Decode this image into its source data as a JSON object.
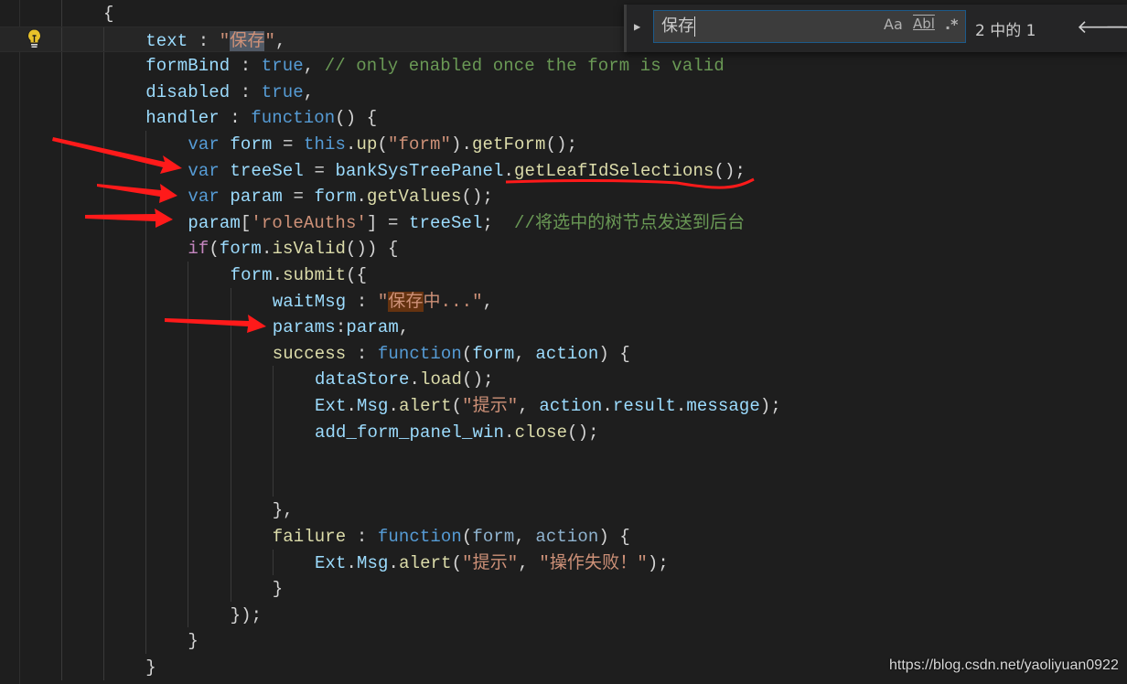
{
  "editor": {
    "current_line": 1,
    "lines": [
      {
        "indent": 0,
        "tokens": [
          {
            "t": "{",
            "c": "pun"
          }
        ]
      },
      {
        "indent": 1,
        "tokens": [
          {
            "t": "text",
            "c": "prop"
          },
          {
            "t": " : ",
            "c": "pun"
          },
          {
            "t": "\"",
            "c": "str"
          },
          {
            "t": "保存",
            "c": "str hl-grey"
          },
          {
            "t": "\"",
            "c": "str"
          },
          {
            "t": ",",
            "c": "pun"
          }
        ]
      },
      {
        "indent": 1,
        "tokens": [
          {
            "t": "formBind",
            "c": "prop"
          },
          {
            "t": " : ",
            "c": "pun"
          },
          {
            "t": "true",
            "c": "kw"
          },
          {
            "t": ", ",
            "c": "pun"
          },
          {
            "t": "// only enabled once the form is valid",
            "c": "com"
          }
        ]
      },
      {
        "indent": 1,
        "tokens": [
          {
            "t": "disabled",
            "c": "prop"
          },
          {
            "t": " : ",
            "c": "pun"
          },
          {
            "t": "true",
            "c": "kw"
          },
          {
            "t": ",",
            "c": "pun"
          }
        ]
      },
      {
        "indent": 1,
        "tokens": [
          {
            "t": "handler",
            "c": "prop"
          },
          {
            "t": " : ",
            "c": "pun"
          },
          {
            "t": "function",
            "c": "kw"
          },
          {
            "t": "() {",
            "c": "pun"
          }
        ]
      },
      {
        "indent": 2,
        "tokens": [
          {
            "t": "var",
            "c": "kw"
          },
          {
            "t": " ",
            "c": "pun"
          },
          {
            "t": "form",
            "c": "prop"
          },
          {
            "t": " = ",
            "c": "pun"
          },
          {
            "t": "this",
            "c": "kw"
          },
          {
            "t": ".",
            "c": "pun"
          },
          {
            "t": "up",
            "c": "fn"
          },
          {
            "t": "(",
            "c": "pun"
          },
          {
            "t": "\"form\"",
            "c": "str"
          },
          {
            "t": ").",
            "c": "pun"
          },
          {
            "t": "getForm",
            "c": "fn"
          },
          {
            "t": "();",
            "c": "pun"
          }
        ]
      },
      {
        "indent": 2,
        "tokens": [
          {
            "t": "var",
            "c": "kw"
          },
          {
            "t": " ",
            "c": "pun"
          },
          {
            "t": "treeSel",
            "c": "prop"
          },
          {
            "t": " = ",
            "c": "pun"
          },
          {
            "t": "bankSysTreePanel",
            "c": "prop"
          },
          {
            "t": ".",
            "c": "pun"
          },
          {
            "t": "getLeafIdSelections",
            "c": "fn"
          },
          {
            "t": "();",
            "c": "pun"
          }
        ]
      },
      {
        "indent": 2,
        "tokens": [
          {
            "t": "var",
            "c": "kw"
          },
          {
            "t": " ",
            "c": "pun"
          },
          {
            "t": "param",
            "c": "prop"
          },
          {
            "t": " = ",
            "c": "pun"
          },
          {
            "t": "form",
            "c": "prop"
          },
          {
            "t": ".",
            "c": "pun"
          },
          {
            "t": "getValues",
            "c": "fn"
          },
          {
            "t": "();",
            "c": "pun"
          }
        ]
      },
      {
        "indent": 2,
        "tokens": [
          {
            "t": "param",
            "c": "prop"
          },
          {
            "t": "[",
            "c": "pun"
          },
          {
            "t": "'roleAuths'",
            "c": "str"
          },
          {
            "t": "] = ",
            "c": "pun"
          },
          {
            "t": "treeSel",
            "c": "prop"
          },
          {
            "t": ";  ",
            "c": "pun"
          },
          {
            "t": "//将选中的树节点发送到后台",
            "c": "com"
          }
        ]
      },
      {
        "indent": 2,
        "tokens": [
          {
            "t": "if",
            "c": "ctl"
          },
          {
            "t": "(",
            "c": "pun"
          },
          {
            "t": "form",
            "c": "prop"
          },
          {
            "t": ".",
            "c": "pun"
          },
          {
            "t": "isValid",
            "c": "fn"
          },
          {
            "t": "()) {",
            "c": "pun"
          }
        ]
      },
      {
        "indent": 3,
        "tokens": [
          {
            "t": "form",
            "c": "prop"
          },
          {
            "t": ".",
            "c": "pun"
          },
          {
            "t": "submit",
            "c": "fn"
          },
          {
            "t": "({",
            "c": "pun"
          }
        ]
      },
      {
        "indent": 4,
        "tokens": [
          {
            "t": "waitMsg",
            "c": "prop"
          },
          {
            "t": " : ",
            "c": "pun"
          },
          {
            "t": "\"",
            "c": "str"
          },
          {
            "t": "保存",
            "c": "str hl-orange"
          },
          {
            "t": "中...\"",
            "c": "str"
          },
          {
            "t": ",",
            "c": "pun"
          }
        ]
      },
      {
        "indent": 4,
        "tokens": [
          {
            "t": "params",
            "c": "prop"
          },
          {
            "t": ":",
            "c": "pun"
          },
          {
            "t": "param",
            "c": "prop"
          },
          {
            "t": ",",
            "c": "pun"
          }
        ]
      },
      {
        "indent": 4,
        "tokens": [
          {
            "t": "success",
            "c": "fn"
          },
          {
            "t": " : ",
            "c": "pun"
          },
          {
            "t": "function",
            "c": "kw"
          },
          {
            "t": "(",
            "c": "pun"
          },
          {
            "t": "form",
            "c": "prop"
          },
          {
            "t": ", ",
            "c": "pun"
          },
          {
            "t": "action",
            "c": "prop"
          },
          {
            "t": ") {",
            "c": "pun"
          }
        ]
      },
      {
        "indent": 5,
        "tokens": [
          {
            "t": "dataStore",
            "c": "prop"
          },
          {
            "t": ".",
            "c": "pun"
          },
          {
            "t": "load",
            "c": "fn"
          },
          {
            "t": "();",
            "c": "pun"
          }
        ]
      },
      {
        "indent": 5,
        "tokens": [
          {
            "t": "Ext",
            "c": "prop"
          },
          {
            "t": ".",
            "c": "pun"
          },
          {
            "t": "Msg",
            "c": "prop"
          },
          {
            "t": ".",
            "c": "pun"
          },
          {
            "t": "alert",
            "c": "fn"
          },
          {
            "t": "(",
            "c": "pun"
          },
          {
            "t": "\"提示\"",
            "c": "str"
          },
          {
            "t": ", ",
            "c": "pun"
          },
          {
            "t": "action",
            "c": "prop"
          },
          {
            "t": ".",
            "c": "pun"
          },
          {
            "t": "result",
            "c": "prop"
          },
          {
            "t": ".",
            "c": "pun"
          },
          {
            "t": "message",
            "c": "prop"
          },
          {
            "t": ");",
            "c": "pun"
          }
        ]
      },
      {
        "indent": 5,
        "tokens": [
          {
            "t": "add_form_panel_win",
            "c": "prop"
          },
          {
            "t": ".",
            "c": "pun"
          },
          {
            "t": "close",
            "c": "fn"
          },
          {
            "t": "();",
            "c": "pun"
          }
        ]
      },
      {
        "indent": 5,
        "tokens": []
      },
      {
        "indent": 5,
        "tokens": []
      },
      {
        "indent": 4,
        "tokens": [
          {
            "t": "},",
            "c": "pun"
          }
        ]
      },
      {
        "indent": 4,
        "tokens": [
          {
            "t": "failure",
            "c": "fn"
          },
          {
            "t": " : ",
            "c": "pun"
          },
          {
            "t": "function",
            "c": "kw"
          },
          {
            "t": "(",
            "c": "pun"
          },
          {
            "t": "form",
            "c": "par"
          },
          {
            "t": ", ",
            "c": "pun"
          },
          {
            "t": "action",
            "c": "par"
          },
          {
            "t": ") {",
            "c": "pun"
          }
        ]
      },
      {
        "indent": 5,
        "tokens": [
          {
            "t": "Ext",
            "c": "prop"
          },
          {
            "t": ".",
            "c": "pun"
          },
          {
            "t": "Msg",
            "c": "prop"
          },
          {
            "t": ".",
            "c": "pun"
          },
          {
            "t": "alert",
            "c": "fn"
          },
          {
            "t": "(",
            "c": "pun"
          },
          {
            "t": "\"提示\"",
            "c": "str"
          },
          {
            "t": ", ",
            "c": "pun"
          },
          {
            "t": "\"操作失败！\"",
            "c": "str"
          },
          {
            "t": ");",
            "c": "pun"
          }
        ]
      },
      {
        "indent": 4,
        "tokens": [
          {
            "t": "}",
            "c": "pun"
          }
        ]
      },
      {
        "indent": 3,
        "tokens": [
          {
            "t": "});",
            "c": "pun"
          }
        ]
      },
      {
        "indent": 2,
        "tokens": [
          {
            "t": "}",
            "c": "pun"
          }
        ]
      },
      {
        "indent": 1,
        "tokens": [
          {
            "t": "}",
            "c": "pun"
          }
        ]
      }
    ]
  },
  "find_widget": {
    "query": "保存",
    "match_case_label": "Aa",
    "whole_word_label": "Abl",
    "regex_label": ".*",
    "match_count": "2 中的 1",
    "prev_icon": "arrow-left-icon",
    "next_icon": "arrow-right-icon"
  },
  "gutter": {
    "icon": "lightbulb-icon"
  },
  "annotations": {
    "color": "#ff1a1a"
  },
  "watermark": "https://blog.csdn.net/yaoliyuan0922"
}
